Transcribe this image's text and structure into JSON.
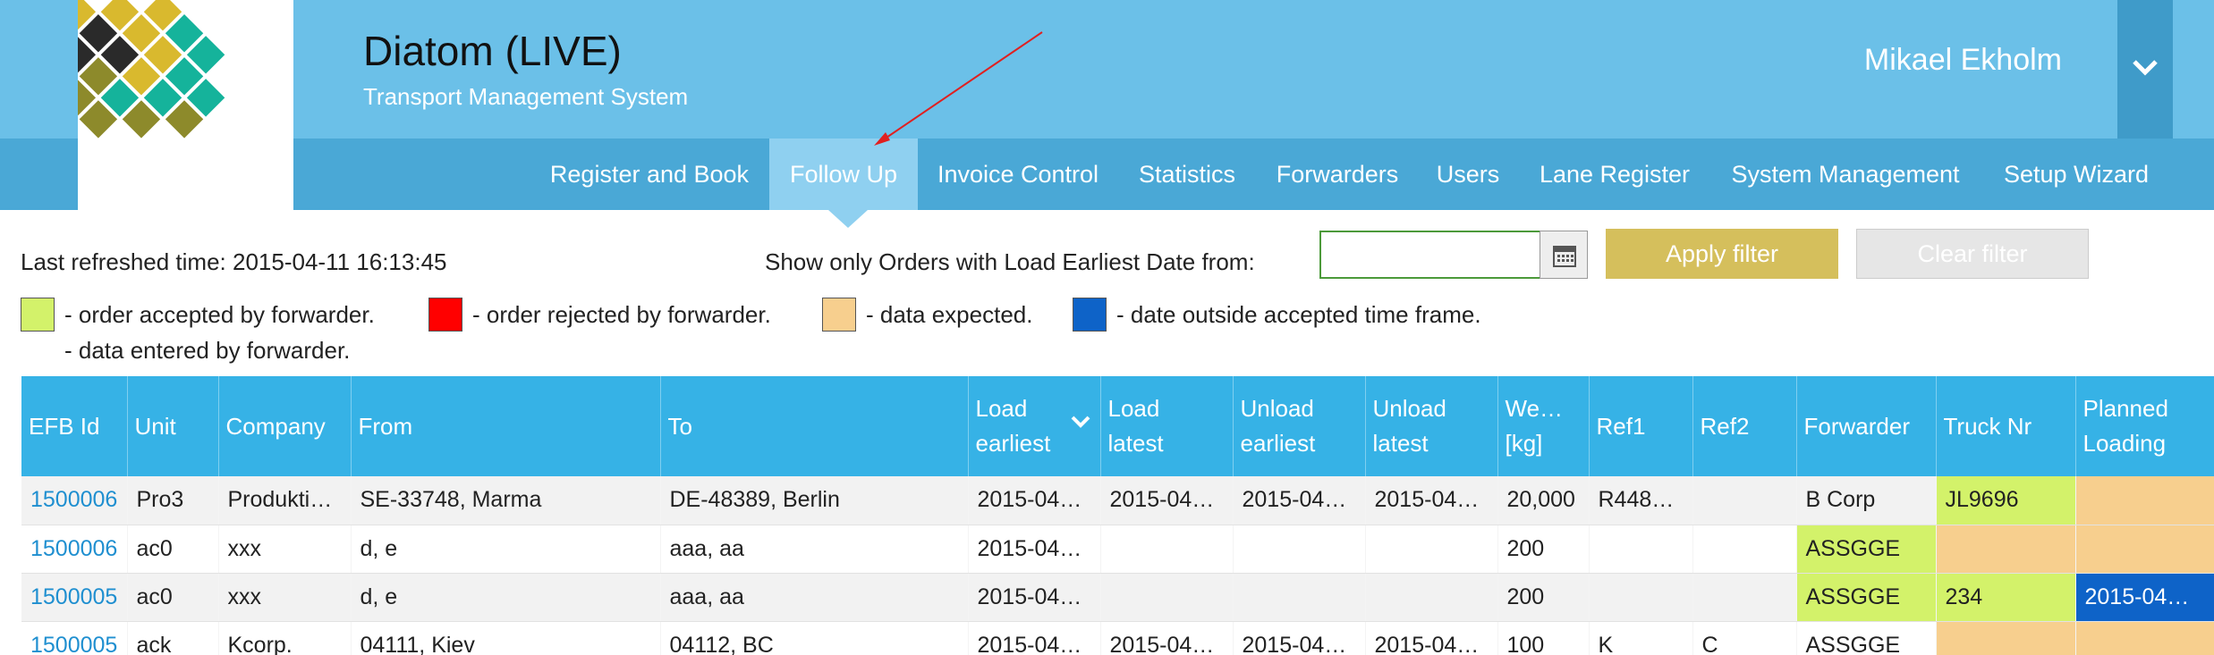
{
  "app": {
    "title": "Diatom (LIVE)",
    "subtitle": "Transport Management System",
    "user": "Mikael Ekholm"
  },
  "nav": {
    "items": [
      {
        "label": "Register and Book"
      },
      {
        "label": "Follow Up",
        "active": true
      },
      {
        "label": "Invoice Control"
      },
      {
        "label": "Statistics"
      },
      {
        "label": "Forwarders"
      },
      {
        "label": "Users"
      },
      {
        "label": "Lane Register"
      },
      {
        "label": "System Management"
      },
      {
        "label": "Setup Wizard"
      }
    ]
  },
  "toolbar": {
    "refreshed": "Last refreshed time: 2015-04-11 16:13:45",
    "filter_label": "Show only Orders with Load Earliest Date from:",
    "date_value": "",
    "apply_label": "Apply filter",
    "clear_label": "Clear filter"
  },
  "legend": {
    "accepted": "- order accepted by forwarder.",
    "rejected": "- order rejected by forwarder.",
    "expected": "- data expected.",
    "outside": "- date outside accepted time frame.",
    "entered": "- data entered by forwarder."
  },
  "colors": {
    "header": "#6bc0e8",
    "nav": "#4aa8d6",
    "table_header": "#36b2e6",
    "accepted": "#d3f26a",
    "rejected": "#ff0000",
    "expected": "#f7cf8e",
    "outside": "#0e63c8",
    "apply_button": "#d5bf5c"
  },
  "table": {
    "headers": {
      "efb_id": "EFB Id",
      "unit": "Unit",
      "company": "Company",
      "from": "From",
      "to": "To",
      "load_earliest_1": "Load",
      "load_earliest_2": "earliest",
      "load_latest_1": "Load",
      "load_latest_2": "latest",
      "unload_earliest_1": "Unload",
      "unload_earliest_2": "earliest",
      "unload_latest_1": "Unload",
      "unload_latest_2": "latest",
      "weight_1": "We…",
      "weight_2": "[kg]",
      "ref1": "Ref1",
      "ref2": "Ref2",
      "forwarder": "Forwarder",
      "truck_nr": "Truck Nr",
      "planned_loading_1": "Planned",
      "planned_loading_2": "Loading"
    },
    "rows": [
      {
        "efb_id": "1500006",
        "unit": "Pro3",
        "company": "Produkti…",
        "from": "SE-33748, Marma",
        "to": "DE-48389, Berlin",
        "load_earliest": "2015-04…",
        "load_latest": "2015-04…",
        "unload_earliest": "2015-04…",
        "unload_latest": "2015-04…",
        "weight": "20,000",
        "ref1": "R448…",
        "ref2": "",
        "forwarder": "B Corp",
        "truck_nr": "JL9696",
        "planned_loading": ""
      },
      {
        "efb_id": "1500006",
        "unit": "ac0",
        "company": "xxx",
        "from": "d, e",
        "to": "aaa, aa",
        "load_earliest": "2015-04…",
        "load_latest": "",
        "unload_earliest": "",
        "unload_latest": "",
        "weight": "200",
        "ref1": "",
        "ref2": "",
        "forwarder": "ASSGGE",
        "truck_nr": "",
        "planned_loading": ""
      },
      {
        "efb_id": "1500005",
        "unit": "ac0",
        "company": "xxx",
        "from": "d, e",
        "to": "aaa, aa",
        "load_earliest": "2015-04…",
        "load_latest": "",
        "unload_earliest": "",
        "unload_latest": "",
        "weight": "200",
        "ref1": "",
        "ref2": "",
        "forwarder": "ASSGGE",
        "truck_nr": "234",
        "planned_loading": "2015-04…"
      },
      {
        "efb_id": "1500005",
        "unit": "ack",
        "company": "Kcorp.",
        "from": "04111, Kiev",
        "to": "04112, BC",
        "load_earliest": "2015-04…",
        "load_latest": "2015-04…",
        "unload_earliest": "2015-04…",
        "unload_latest": "2015-04…",
        "weight": "100",
        "ref1": "K",
        "ref2": "C",
        "forwarder": "ASSGGE",
        "truck_nr": "",
        "planned_loading": ""
      }
    ]
  }
}
